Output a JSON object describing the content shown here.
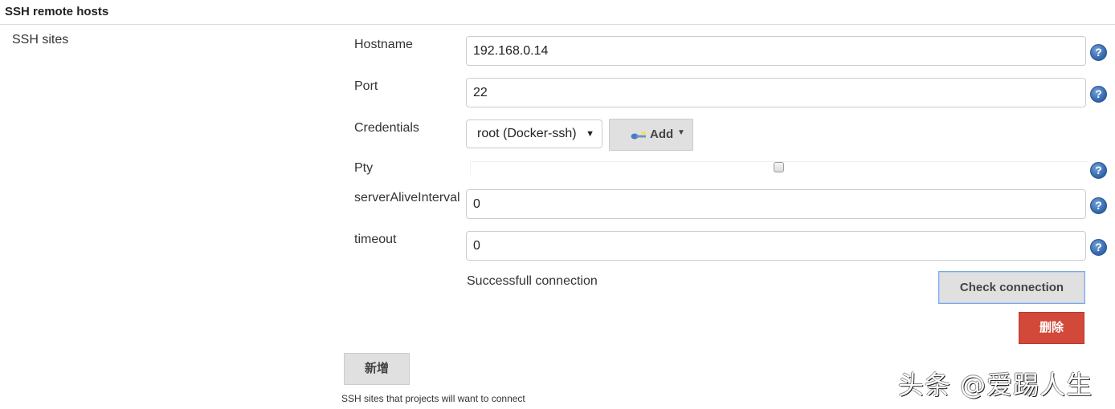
{
  "section": {
    "title": "SSH remote hosts",
    "group_label": "SSH sites"
  },
  "fields": {
    "hostname": {
      "label": "Hostname",
      "value": "192.168.0.14"
    },
    "port": {
      "label": "Port",
      "value": "22"
    },
    "credentials": {
      "label": "Credentials",
      "selected": "root (Docker-ssh)",
      "add_label": "Add"
    },
    "pty": {
      "label": "Pty",
      "checked": false
    },
    "server_alive_interval": {
      "label": "serverAliveInterval",
      "value": "0"
    },
    "timeout": {
      "label": "timeout",
      "value": "0"
    }
  },
  "help_icon_glyph": "?",
  "status": "Successfull connection",
  "buttons": {
    "check_connection": "Check connection",
    "delete": "删除",
    "add_new": "新增"
  },
  "help_text": "SSH sites that projects will want to connect",
  "watermark": "头条 @爱踢人生",
  "colors": {
    "delete_button": "#d24939",
    "help_icon": "#3a6fb5",
    "button_gray": "#e0e0e0"
  }
}
